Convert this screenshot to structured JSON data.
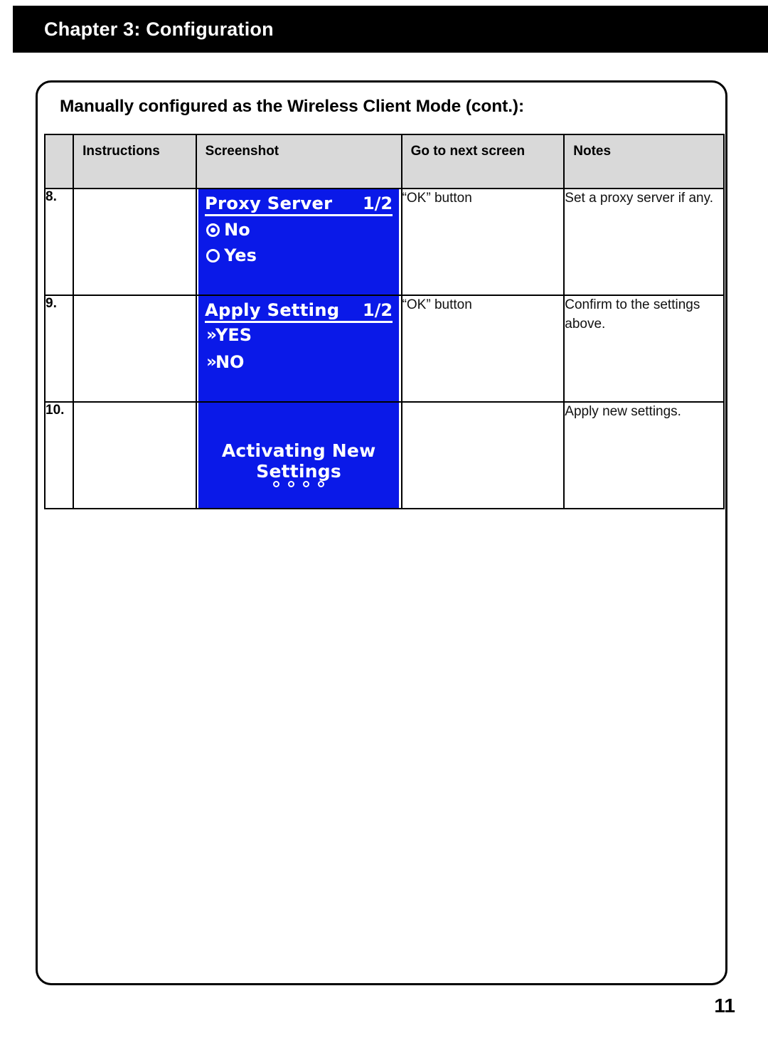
{
  "header": {
    "chapter_title": "Chapter 3: Configuration"
  },
  "panel": {
    "title": "Manually configured as the Wireless Client Mode (cont.):"
  },
  "table": {
    "headers": {
      "num": "",
      "instructions": "Instructions",
      "screenshot": "Screenshot",
      "next": "Go to next screen",
      "notes": "Notes"
    },
    "rows": [
      {
        "num": "8.",
        "instructions": "",
        "screen": {
          "title": "Proxy Server",
          "page": "1/2",
          "options": [
            {
              "label": "No",
              "selected": true
            },
            {
              "label": "Yes",
              "selected": false
            }
          ]
        },
        "next": "“OK” button",
        "notes": "Set a proxy server if any."
      },
      {
        "num": "9.",
        "instructions": "",
        "screen": {
          "title": "Apply Setting",
          "page": "1/2",
          "items": [
            {
              "label": "YES"
            },
            {
              "label": "NO"
            }
          ]
        },
        "next": "“OK” button",
        "notes": "Confirm to the settings above."
      },
      {
        "num": "10.",
        "instructions": "",
        "screen": {
          "message": "Activating New Settings",
          "progress_dots": 4
        },
        "next": "",
        "notes": "Apply new settings."
      }
    ]
  },
  "footer": {
    "page_number": "11"
  },
  "colors": {
    "lcd_background": "#0a19e8",
    "lcd_foreground": "#ffffff",
    "header_bar": "#000000",
    "table_header_fill": "#d9d9d9"
  }
}
